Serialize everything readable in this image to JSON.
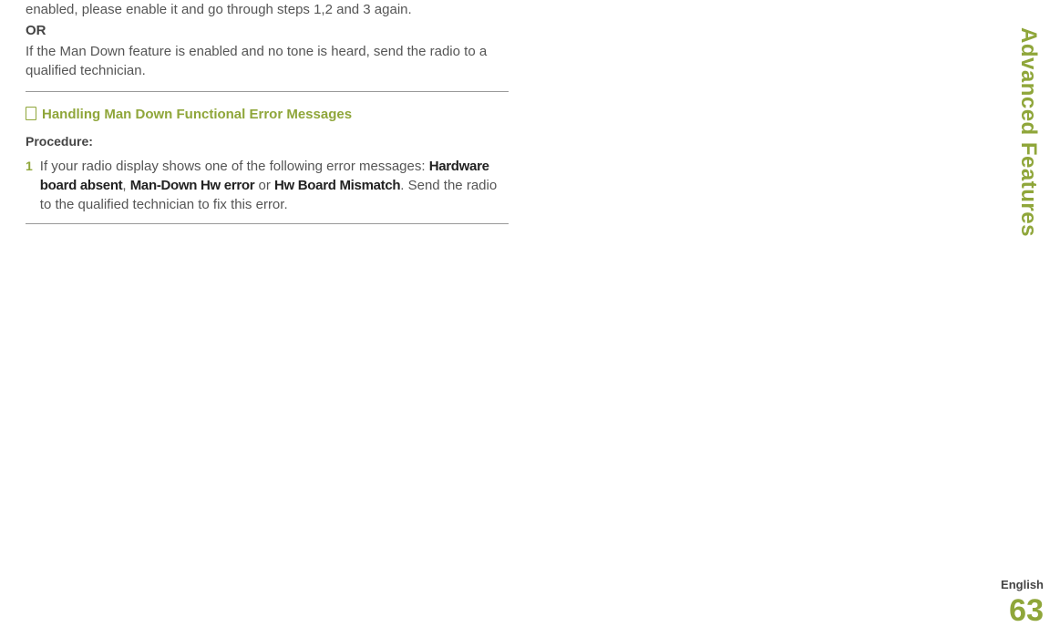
{
  "intro": {
    "line1": "enabled, please enable it and go through steps 1,2 and 3 again.",
    "or": "OR",
    "line2": "If the Man Down feature is enabled and no tone is heard, send the radio to a qualified technician."
  },
  "section": {
    "heading": "Handling Man Down Functional Error Messages",
    "procedure_label": "Procedure:",
    "step_num": "1",
    "step_part1": "If your radio display shows one of the following error messages: ",
    "msg1": "Hardware board absent",
    "sep1": ", ",
    "msg2": "Man-Down Hw error",
    "sep2": " or ",
    "msg3": "Hw Board Mismatch",
    "step_part2": ". Send the radio to the qualified technician to fix this error."
  },
  "side_tab": "Advanced Features",
  "footer": {
    "lang": "English",
    "page": "63"
  }
}
